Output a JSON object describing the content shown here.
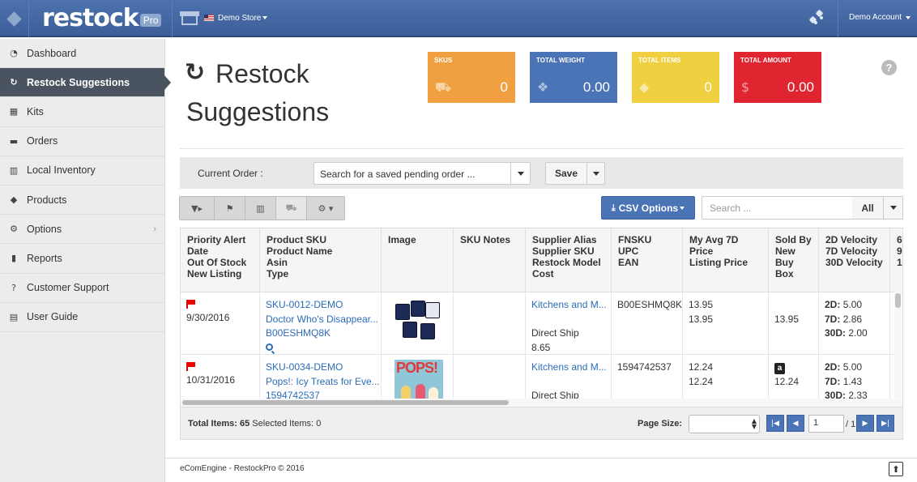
{
  "app": {
    "logo_text": "restock",
    "logo_badge": "Pro"
  },
  "topbar": {
    "store_name": "Demo Store",
    "account_label": "Demo Account"
  },
  "sidebar": {
    "items": [
      {
        "label": "Dashboard",
        "icon": "tachometer-icon",
        "glyph": "◔"
      },
      {
        "label": "Restock Suggestions",
        "icon": "refresh-icon",
        "glyph": "↻",
        "active": true
      },
      {
        "label": "Kits",
        "icon": "cubes-icon",
        "glyph": "▦"
      },
      {
        "label": "Orders",
        "icon": "truck-icon",
        "glyph": "▬"
      },
      {
        "label": "Local Inventory",
        "icon": "building-icon",
        "glyph": "▥"
      },
      {
        "label": "Products",
        "icon": "tags-icon",
        "glyph": "◆"
      },
      {
        "label": "Options",
        "icon": "gear-icon",
        "glyph": "⚙",
        "chevron": "›"
      },
      {
        "label": "Reports",
        "icon": "bar-chart-icon",
        "glyph": "▮"
      },
      {
        "label": "Customer Support",
        "icon": "question-circle-icon",
        "glyph": "?"
      },
      {
        "label": "User Guide",
        "icon": "book-icon",
        "glyph": "▤"
      }
    ]
  },
  "page": {
    "title": "Restock Suggestions",
    "title_icon": "↻"
  },
  "cards": [
    {
      "label": "SKUs",
      "value": "0",
      "color": "#f0a040",
      "icon": "shopping-cart-icon",
      "glyph": "⛟"
    },
    {
      "label": "Total Weight",
      "value": "0.00",
      "color": "#4a74b5",
      "icon": "cubes-icon",
      "glyph": "❖"
    },
    {
      "label": "Total Items",
      "value": "0",
      "color": "#f0d040",
      "icon": "tags-icon",
      "glyph": "◆"
    },
    {
      "label": "Total Amount",
      "value": "0.00",
      "color": "#e02530",
      "icon": "dollar-icon",
      "glyph": "$"
    }
  ],
  "order_bar": {
    "label": "Current Order :",
    "order_select": "Search for a saved pending order ...",
    "save_label": "Save"
  },
  "toolbar": {
    "csv_label": "CSV Options",
    "search_placeholder": "Search ...",
    "filter_scope": "All"
  },
  "grid": {
    "headers": [
      [
        "Priority Alert",
        "Date",
        "Out Of Stock",
        "New Listing"
      ],
      [
        "Product SKU",
        "Product Name",
        "Asin",
        "Type"
      ],
      [
        "Image"
      ],
      [
        "SKU Notes"
      ],
      [
        "Supplier Alias",
        "Supplier SKU",
        "Restock Model",
        "Cost"
      ],
      [
        "FNSKU",
        "UPC",
        "EAN"
      ],
      [
        "My Avg 7D Price",
        "Listing Price"
      ],
      [
        "Sold By",
        "New Buy",
        "Box"
      ],
      [
        "2D Velocity",
        "7D Velocity",
        "30D Velocity"
      ],
      [
        "6",
        "9",
        "1"
      ]
    ],
    "rows": [
      {
        "date": "9/30/2016",
        "sku": "SKU-0012-DEMO",
        "name": "Doctor Who's Disappear...",
        "asin": "B00ESHMQ8K",
        "supplier": "Kitchens and M...",
        "restock_model": "Direct Ship",
        "cost": "8.65",
        "fnsku": "B00ESHMQ8K",
        "avg_price": "13.95",
        "listing_price": "13.95",
        "buybox": "13.95",
        "vel_2d": "5.00",
        "vel_7d": "2.86",
        "vel_30d": "2.00"
      },
      {
        "date": "10/31/2016",
        "sku": "SKU-0034-DEMO",
        "name": "Pops!: Icy Treats for Eve...",
        "asin": "1594742537",
        "supplier": "Kitchens and M...",
        "restock_model": "Direct Ship",
        "fnsku": "1594742537",
        "avg_price": "12.24",
        "listing_price": "12.24",
        "buybox": "12.24",
        "vel_2d": "5.00",
        "vel_7d": "1.43",
        "vel_30d": "2.33",
        "image_text": "POPS!"
      }
    ],
    "velocity_labels": {
      "d2": "2D:",
      "d7": "7D:",
      "d30": "30D:"
    }
  },
  "grid_footer": {
    "total_label": "Total Items:",
    "total_value": "65",
    "selected_label": "Selected Items:",
    "selected_value": "0",
    "page_size_label": "Page Size:",
    "current_page": "1",
    "page_of": "/ 1"
  },
  "footer": {
    "copyright": "eComEngine - RestockPro © 2016"
  }
}
